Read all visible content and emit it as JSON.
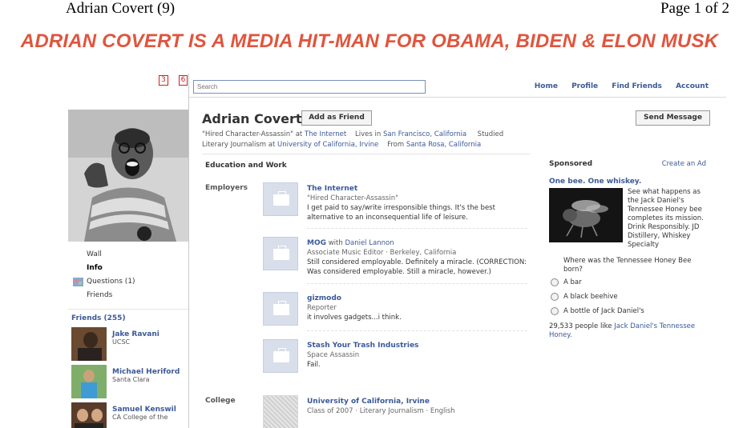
{
  "doc_header": {
    "left": "Adrian Covert (9)",
    "right": "Page 1 of 2"
  },
  "headline": "ADRIAN COVERT IS A MEDIA HIT-MAN FOR OBAMA, BIDEN & ELON MUSK",
  "mini_badges": [
    "3",
    "6"
  ],
  "topbar": {
    "search_placeholder": "Search",
    "nav": [
      "Home",
      "Profile",
      "Find Friends",
      "Account"
    ]
  },
  "profile": {
    "name": "Adrian Covert",
    "add_friend": "Add as Friend",
    "send_message": "Send Message",
    "info_line1": {
      "quote": "\"Hired Character-Assassin\" at ",
      "employer": "The Internet",
      "lives_prefix": "Lives in ",
      "lives": "San Francisco, California",
      "studied_prefix": "Studied"
    },
    "info_line2": {
      "study_prefix": "Literary Journalism at ",
      "school": "University of California, Irvine",
      "from_prefix": "From ",
      "from": "Santa Rosa, California"
    }
  },
  "left_nav": {
    "items": [
      "Wall",
      "Info",
      "Questions (1)",
      "Friends"
    ],
    "friends_title": "Friends (255)",
    "friends": [
      {
        "name": "Jake Ravani",
        "network": "UCSC"
      },
      {
        "name": "Michael Heriford",
        "network": "Santa Clara"
      },
      {
        "name": "Samuel Kenswil",
        "network": "CA College of the"
      }
    ]
  },
  "education_work": {
    "title": "Education and Work",
    "employers_label": "Employers",
    "college_label": "College",
    "jobs": [
      {
        "title": "The Internet",
        "with_prefix": "",
        "with": "",
        "meta": "\"Hired Character-Assassin\"",
        "desc": "I get paid to say/write irresponsible things. It's the best alternative to an inconsequential life of leisure."
      },
      {
        "title": "MOG",
        "with_prefix": " with ",
        "with": "Daniel Lannon",
        "meta": "Associate Music Editor · Berkeley, California",
        "desc": "Still considered employable. Definitely a miracle. (CORRECTION: Was considered employable. Still a miracle, however.)"
      },
      {
        "title": "gizmodo",
        "with_prefix": "",
        "with": "",
        "meta": "Reporter",
        "desc": "it involves gadgets...i think."
      },
      {
        "title": "Stash Your Trash Industries",
        "with_prefix": "",
        "with": "",
        "meta": "Space Assassin",
        "desc": "Fail."
      }
    ],
    "college": {
      "title": "University of California, Irvine",
      "meta": "Class of 2007 · Literary Journalism · English"
    }
  },
  "sponsored": {
    "title": "Sponsored",
    "create_ad": "Create an Ad",
    "ad_title": "One bee. One whiskey.",
    "ad_text": "See what happens as the Jack Daniel's Tennessee Honey bee completes its mission. Drink Responsibly. JD Distillery, Whiskey Specialty",
    "question": "Where was the Tennessee Honey Bee born?",
    "options": [
      "A bar",
      "A black beehive",
      "A bottle of Jack Daniel's"
    ],
    "likes_prefix": "29,533 people like ",
    "likes_link": "Jack Daniel's Tennessee Honey."
  },
  "colors": {
    "headline": "#e0553d",
    "link": "#3b5998",
    "badge": "#cc2222"
  }
}
